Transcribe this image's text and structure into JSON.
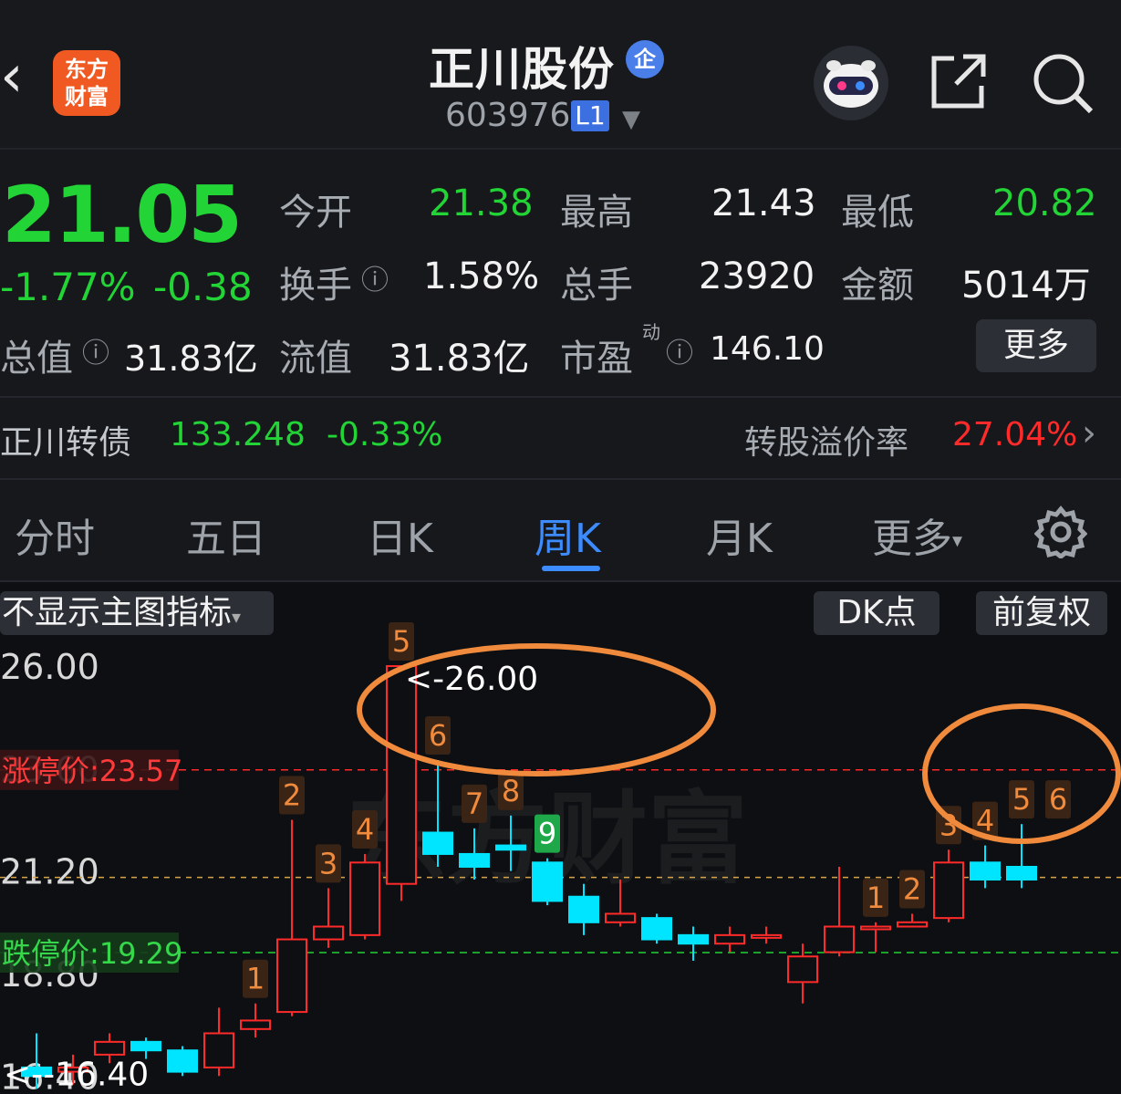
{
  "header": {
    "back_icon": "chevron-left-icon",
    "app_logo_text_1": "东方",
    "app_logo_text_2": "财富",
    "stock_name": "正川股份",
    "enterprise_badge": "企",
    "stock_code": "603976",
    "level_badge": "L1"
  },
  "quote": {
    "price": "21.05",
    "change_pct": "-1.77%",
    "change_amt": "-0.38",
    "open_label": "今开",
    "open_value": "21.38",
    "high_label": "最高",
    "high_value": "21.43",
    "low_label": "最低",
    "low_value": "20.82",
    "turnover_label": "换手",
    "turnover_value": "1.58%",
    "volume_label": "总手",
    "volume_value": "23920",
    "amount_label": "金额",
    "amount_value": "5014万",
    "mktcap_label": "总值",
    "mktcap_value": "31.83亿",
    "float_label": "流值",
    "float_value": "31.83亿",
    "pe_label": "市盈",
    "pe_sup": "动",
    "pe_value": "146.10",
    "more_label": "更多"
  },
  "bond": {
    "name": "正川转债",
    "price": "133.248",
    "change_pct": "-0.33%",
    "premium_label": "转股溢价率",
    "premium_value": "27.04%"
  },
  "tabs": [
    {
      "label": "分时",
      "active": false
    },
    {
      "label": "五日",
      "active": false
    },
    {
      "label": "日K",
      "active": false
    },
    {
      "label": "周K",
      "active": true
    },
    {
      "label": "月K",
      "active": false
    },
    {
      "label": "更多",
      "active": false
    }
  ],
  "chart_toolbar": {
    "indicator_select": "不显示主图指标",
    "dk_button": "DK点",
    "adjust_button": "前复权"
  },
  "chart_data": {
    "type": "candlestick",
    "y_ticks": [
      "26.00",
      "23.60",
      "21.20",
      "18.80",
      "16.40"
    ],
    "limit_up_label": "涨停价:23.57",
    "limit_up_value": 23.57,
    "limit_down_label": "跌停价:19.29",
    "limit_down_value": 19.29,
    "current_price_line": 21.05,
    "max_marker": "<-26.00",
    "min_marker": "<--16.40",
    "watermark": "东方财富",
    "ylim": [
      16.0,
      26.3
    ],
    "candles": [
      {
        "o": 16.6,
        "c": 16.4,
        "h": 17.4,
        "l": 16.1
      },
      {
        "o": 16.5,
        "c": 16.6,
        "h": 16.9,
        "l": 16.2
      },
      {
        "o": 16.9,
        "c": 17.2,
        "h": 17.4,
        "l": 16.7
      },
      {
        "o": 17.2,
        "c": 17.0,
        "h": 17.3,
        "l": 16.8
      },
      {
        "o": 17.0,
        "c": 16.5,
        "h": 17.1,
        "l": 16.4
      },
      {
        "o": 16.6,
        "c": 17.4,
        "h": 18.0,
        "l": 16.4
      },
      {
        "o": 17.5,
        "c": 17.7,
        "h": 18.1,
        "l": 17.3
      },
      {
        "o": 17.9,
        "c": 19.6,
        "h": 22.4,
        "l": 17.8
      },
      {
        "o": 19.6,
        "c": 19.9,
        "h": 20.8,
        "l": 19.4
      },
      {
        "o": 19.7,
        "c": 21.4,
        "h": 21.6,
        "l": 19.6
      },
      {
        "o": 20.9,
        "c": 26.0,
        "h": 26.0,
        "l": 20.5
      },
      {
        "o": 22.1,
        "c": 21.6,
        "h": 23.8,
        "l": 21.3
      },
      {
        "o": 21.6,
        "c": 21.3,
        "h": 22.2,
        "l": 21.0
      },
      {
        "o": 21.8,
        "c": 21.7,
        "h": 22.5,
        "l": 21.2
      },
      {
        "o": 21.4,
        "c": 20.5,
        "h": 21.5,
        "l": 20.4
      },
      {
        "o": 20.6,
        "c": 20.0,
        "h": 20.9,
        "l": 19.7
      },
      {
        "o": 20.0,
        "c": 20.2,
        "h": 21.0,
        "l": 19.9
      },
      {
        "o": 20.1,
        "c": 19.6,
        "h": 20.2,
        "l": 19.5
      },
      {
        "o": 19.7,
        "c": 19.5,
        "h": 19.9,
        "l": 19.1
      },
      {
        "o": 19.5,
        "c": 19.7,
        "h": 19.9,
        "l": 19.3
      },
      {
        "o": 19.7,
        "c": 19.7,
        "h": 19.9,
        "l": 19.5
      },
      {
        "o": 18.6,
        "c": 19.2,
        "h": 19.5,
        "l": 18.1
      },
      {
        "o": 19.3,
        "c": 19.9,
        "h": 21.3,
        "l": 19.2
      },
      {
        "o": 19.9,
        "c": 19.9,
        "h": 20.0,
        "l": 19.3
      },
      {
        "o": 19.9,
        "c": 20.0,
        "h": 20.2,
        "l": 19.9
      },
      {
        "o": 20.1,
        "c": 21.4,
        "h": 21.7,
        "l": 20.0
      },
      {
        "o": 21.4,
        "c": 21.0,
        "h": 21.8,
        "l": 20.8
      },
      {
        "o": 21.3,
        "c": 21.0,
        "h": 22.3,
        "l": 20.8
      }
    ],
    "td_labels": [
      {
        "candle": 7,
        "text": "1",
        "color": "orange"
      },
      {
        "candle": 8,
        "text": "2",
        "color": "orange"
      },
      {
        "candle": 9,
        "text": "3",
        "color": "orange"
      },
      {
        "candle": 10,
        "text": "4",
        "color": "orange"
      },
      {
        "candle": 11,
        "text": "5",
        "color": "orange"
      },
      {
        "candle": 12,
        "text": "6",
        "color": "orange"
      },
      {
        "candle": 13,
        "text": "7",
        "color": "orange"
      },
      {
        "candle": 14,
        "text": "8",
        "color": "orange"
      },
      {
        "candle": 15,
        "text": "9",
        "color": "green"
      },
      {
        "candle": 24,
        "text": "1",
        "color": "orange"
      },
      {
        "candle": 25,
        "text": "2",
        "color": "orange"
      },
      {
        "candle": 26,
        "text": "3",
        "color": "orange"
      },
      {
        "candle": 27,
        "text": "4",
        "color": "orange"
      },
      {
        "candle": 28,
        "text": "5",
        "color": "orange"
      },
      {
        "candle": 29,
        "text": "6",
        "color": "orange"
      }
    ],
    "colors": {
      "up": "#ff2a2a",
      "down": "#00e5ff",
      "annotation": "#f08a3c",
      "limit_up": "#ff2a2a",
      "limit_down": "#22d435"
    }
  }
}
